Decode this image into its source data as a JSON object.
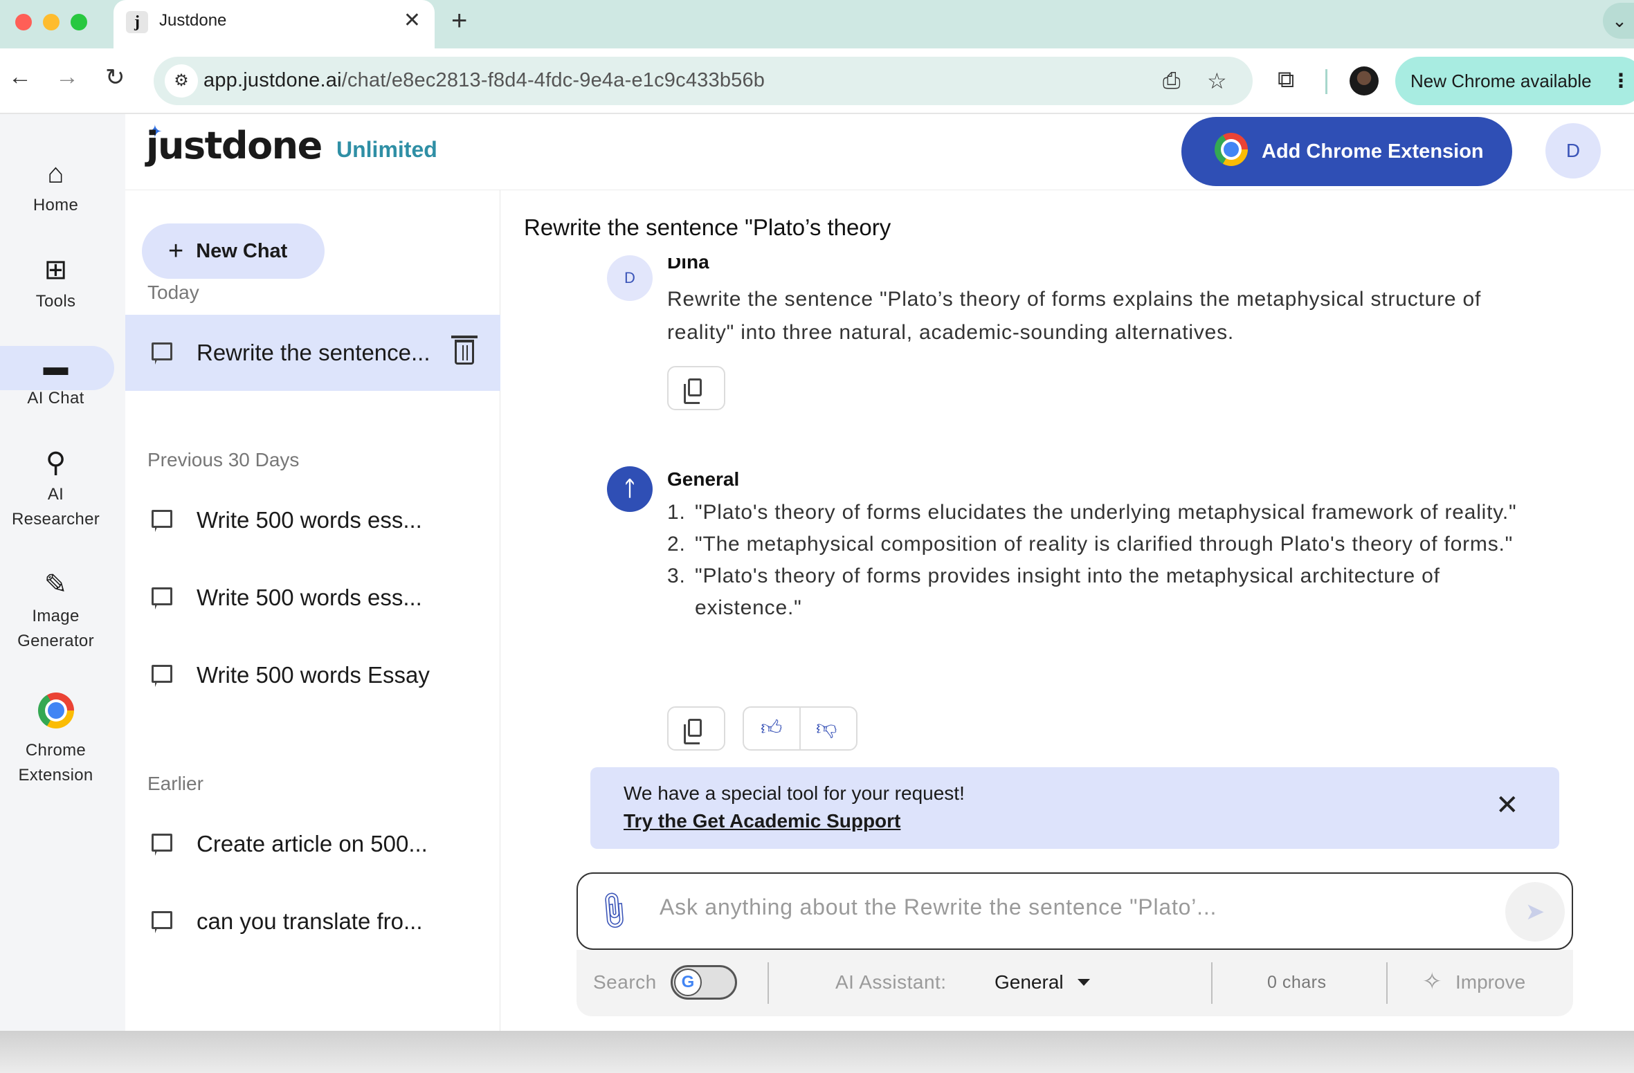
{
  "browser": {
    "tab_title": "Justdone",
    "tab_favicon": "j",
    "tab_close": "✕",
    "new_tab": "+",
    "url_host": "app.justdone.ai",
    "url_path": "/chat/e8ec2813-f8d4-4fdc-9e4a-e1c9c433b56b",
    "update_label": "New Chrome available"
  },
  "rail": {
    "items": [
      {
        "label": "Home",
        "icon": "home-icon"
      },
      {
        "label": "Tools",
        "icon": "grid-icon"
      },
      {
        "label": "AI Chat",
        "icon": "chat-icon"
      },
      {
        "label": "AI Researcher",
        "label_lines": [
          "AI",
          "Researcher"
        ],
        "icon": "search-zoom-icon"
      },
      {
        "label": "Image Generator",
        "label_lines": [
          "Image",
          "Generator"
        ],
        "icon": "brush-icon"
      },
      {
        "label": "Chrome Extension",
        "label_lines": [
          "Chrome",
          "Extension"
        ],
        "icon": "chrome-icon"
      }
    ],
    "active": "AI Chat"
  },
  "header": {
    "logo_text": "justdone",
    "plan_label": "Unlimited",
    "extension_button": "Add Chrome Extension",
    "user_initial": "D"
  },
  "sidebar": {
    "new_chat_label": "New Chat",
    "sections": [
      {
        "heading": "Today",
        "chats": [
          "Rewrite the sentence..."
        ]
      },
      {
        "heading": "Previous 30 Days",
        "chats": [
          "Write 500 words ess...",
          "Write 500 words ess...",
          "Write 500 words Essay"
        ]
      },
      {
        "heading": "Earlier",
        "chats": [
          "Create article on 500...",
          "can you translate fro..."
        ]
      }
    ]
  },
  "chat": {
    "title": "Rewrite the sentence \"Plato’s theory",
    "user_message": {
      "avatar": "D",
      "name": "Dina",
      "text": "Rewrite the sentence \"Plato’s theory of forms explains the metaphysical structure of reality\" into three natural, academic-sounding alternatives."
    },
    "bot_message": {
      "name": "General",
      "items": [
        "\"Plato's theory of forms elucidates the underlying metaphysical framework of reality.\"",
        "\"The metaphysical composition of reality is clarified through Plato's theory of forms.\"",
        "\"Plato's theory of forms provides insight into the metaphysical architecture of existence.\""
      ]
    },
    "banner": {
      "title": "We have a special tool for your request!",
      "link": "Try the Get Academic Support"
    },
    "composer": {
      "placeholder": "Ask anything about the Rewrite the sentence \"Plato’...",
      "value": ""
    },
    "controls": {
      "search_label": "Search",
      "search_enabled": false,
      "assistant_label": "AI Assistant:",
      "assistant_value": "General",
      "chars": "0 chars",
      "improve_label": "Improve"
    }
  },
  "colors": {
    "accent": "#2f4fb5",
    "accent_light": "#dde3fb",
    "plan": "#2f8fa5",
    "browser_frame": "#cfe8e3"
  }
}
